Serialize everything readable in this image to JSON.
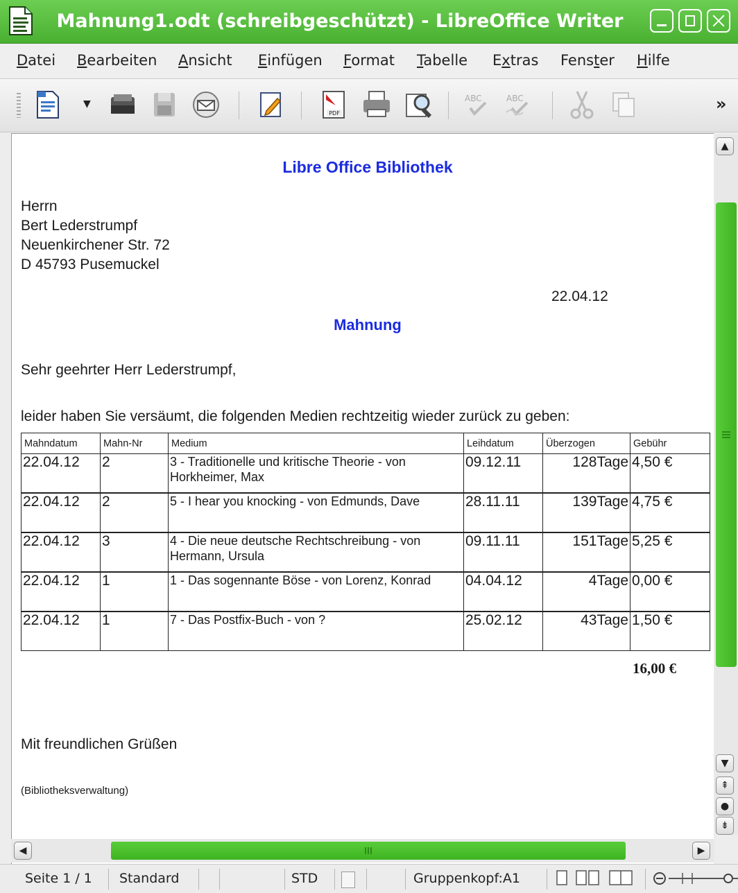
{
  "window": {
    "title": "Mahnung1.odt (schreibgeschützt) - LibreOffice Writer",
    "accent_color": "#4db533"
  },
  "menu": [
    {
      "pre": "",
      "acc": "D",
      "post": "atei"
    },
    {
      "pre": "",
      "acc": "B",
      "post": "earbeiten"
    },
    {
      "pre": "",
      "acc": "A",
      "post": "nsicht"
    },
    {
      "pre": "",
      "acc": "E",
      "post": "infügen"
    },
    {
      "pre": "",
      "acc": "F",
      "post": "ormat"
    },
    {
      "pre": "",
      "acc": "T",
      "post": "abelle"
    },
    {
      "pre": "E",
      "acc": "x",
      "post": "tras"
    },
    {
      "pre": "Fens",
      "acc": "t",
      "post": "er"
    },
    {
      "pre": "",
      "acc": "H",
      "post": "ilfe"
    }
  ],
  "toolbar": {
    "items": [
      "new-document-icon",
      "open-icon",
      "save-icon",
      "email-icon",
      "edit-mode-icon",
      "export-pdf-icon",
      "print-icon",
      "page-preview-icon",
      "spellcheck-icon",
      "autospellcheck-icon",
      "cut-icon",
      "copy-icon"
    ],
    "overflow": "»"
  },
  "document": {
    "org_title": "Libre Office Bibliothek",
    "address": [
      "Herrn",
      "Bert Lederstrumpf",
      "Neuenkirchener Str. 72",
      "D 45793 Pusemuckel"
    ],
    "date": "22.04.12",
    "heading": "Mahnung",
    "salutation": "Sehr geehrter Herr Lederstrumpf,",
    "intro": "leider haben Sie versäumt, die folgenden Medien rechtzeitig wieder zurück zu geben:",
    "table": {
      "headers": [
        "Mahndatum",
        "Mahn-Nr",
        "Medium",
        "Leihdatum",
        "Überzogen",
        "Gebühr"
      ],
      "rows": [
        [
          "22.04.12",
          "2",
          "3 - Traditionelle und kritische Theorie - von Horkheimer, Max",
          "09.12.11",
          "128Tage",
          "4,50 €"
        ],
        [
          "22.04.12",
          "2",
          "5 - I hear you knocking - von Edmunds, Dave",
          "28.11.11",
          "139Tage",
          "4,75 €"
        ],
        [
          "22.04.12",
          "3",
          "4 - Die neue deutsche Rechtschreibung - von Hermann, Ursula",
          "09.11.11",
          "151Tage",
          "5,25 €"
        ],
        [
          "22.04.12",
          "1",
          "1 - Das sogennante Böse - von Lorenz, Konrad",
          "04.04.12",
          "4Tage",
          "0,00 €"
        ],
        [
          "22.04.12",
          "1",
          "7 - Das Postfix-Buch - von ?",
          "25.02.12",
          "43Tage",
          "1,50 €"
        ]
      ]
    },
    "total": "16,00 €",
    "closing": "Mit freundlichen Grüßen",
    "sender": "(Bibliotheksverwaltung)"
  },
  "statusbar": {
    "page": "Seite 1 / 1",
    "page_style": "Standard",
    "mode": "STD",
    "cell_ref": "Gruppenkopf:A1"
  }
}
